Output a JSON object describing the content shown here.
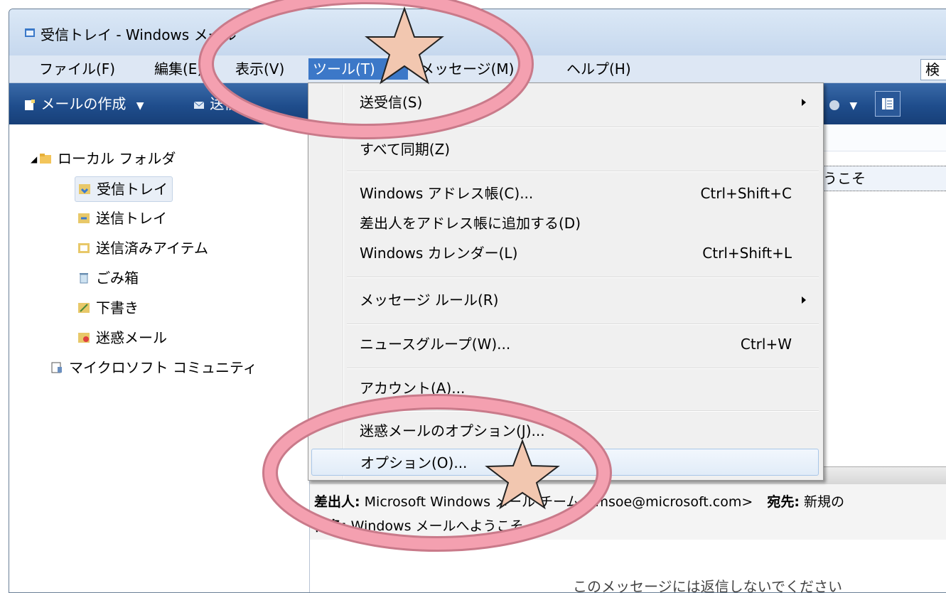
{
  "window": {
    "title": "受信トレイ - Windows メール"
  },
  "menubar": {
    "items": [
      {
        "label": "ファイル(F)"
      },
      {
        "label": "編集(E)"
      },
      {
        "label": "表示(V)"
      },
      {
        "label": "ツール(T)"
      },
      {
        "label": "メッセージ(M)"
      },
      {
        "label": "ヘルプ(H)"
      }
    ],
    "search_label": "検"
  },
  "toolbar": {
    "compose_label": "メールの作成",
    "send_receive_label": "送信"
  },
  "folders": {
    "root": "ローカル フォルダ",
    "items": [
      "受信トレイ",
      "送信トレイ",
      "送信済みアイテム",
      "ごみ箱",
      "下書き",
      "迷惑メール"
    ],
    "community": "マイクロソフト コミュニティ"
  },
  "message_list": {
    "row_subject_fragment": "うこそ"
  },
  "tools_menu": {
    "items": [
      {
        "label": "送受信(S)",
        "shortcut": ""
      },
      {
        "label": "すべて同期(Z)",
        "shortcut": ""
      },
      {
        "label": "Windows アドレス帳(C)...",
        "shortcut": "Ctrl+Shift+C"
      },
      {
        "label": "差出人をアドレス帳に追加する(D)",
        "shortcut": ""
      },
      {
        "label": "Windows カレンダー(L)",
        "shortcut": "Ctrl+Shift+L"
      },
      {
        "label": "メッセージ ルール(R)",
        "shortcut": ""
      },
      {
        "label": "ニュースグループ(W)...",
        "shortcut": "Ctrl+W"
      },
      {
        "label": "アカウント(A)...",
        "shortcut": ""
      },
      {
        "label": "迷惑メールのオプション(J)...",
        "shortcut": ""
      },
      {
        "label": "オプション(O)...",
        "shortcut": ""
      }
    ]
  },
  "preview": {
    "from_label": "差出人:",
    "from_value": "Microsoft Windows メール チーム <msoe@microsoft.com>",
    "to_label": "宛先:",
    "to_value": "新規の",
    "subject_label": "件名:",
    "subject_value": "Windows メールへようこそ",
    "body_text": "このメッセージには返信しないでください"
  },
  "annotation_colors": {
    "ellipse": "#f4a0b0",
    "star": "#f2c7b0"
  }
}
